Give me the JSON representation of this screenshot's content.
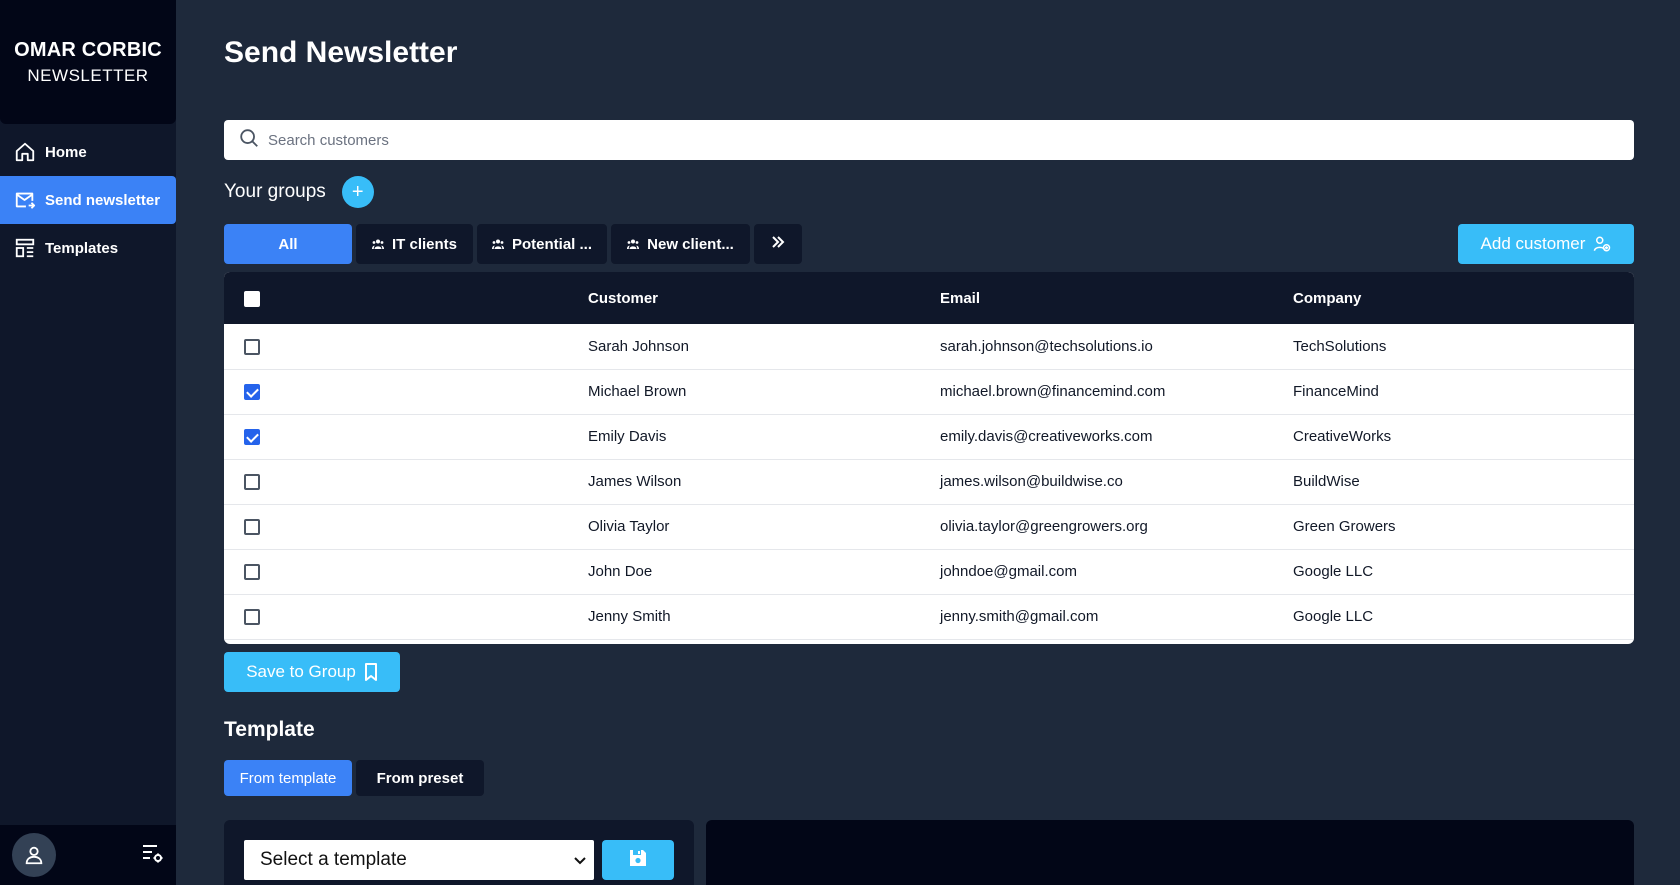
{
  "brand": {
    "name": "OMAR CORBIC",
    "subtitle": "NEWSLETTER"
  },
  "sidebar": {
    "items": [
      {
        "label": "Home",
        "icon": "home-icon",
        "active": false
      },
      {
        "label": "Send newsletter",
        "icon": "mail-send-icon",
        "active": true
      },
      {
        "label": "Templates",
        "icon": "layout-icon",
        "active": false
      }
    ]
  },
  "page": {
    "title": "Send Newsletter"
  },
  "search": {
    "placeholder": "Search customers",
    "value": ""
  },
  "groups": {
    "label": "Your groups",
    "add_label": "+",
    "tabs": [
      {
        "label": "All",
        "active": true
      },
      {
        "label": "IT clients",
        "active": false
      },
      {
        "label": "Potential ...",
        "active": false
      },
      {
        "label": "New client...",
        "active": false
      }
    ],
    "more_icon": "chevrons-right-icon"
  },
  "add_customer": {
    "label": "Add customer"
  },
  "table": {
    "headers": {
      "customer": "Customer",
      "email": "Email",
      "company": "Company"
    },
    "rows": [
      {
        "name": "Sarah Johnson",
        "email": "sarah.johnson@techsolutions.io",
        "company": "TechSolutions",
        "checked": false
      },
      {
        "name": "Michael Brown",
        "email": "michael.brown@financemind.com",
        "company": "FinanceMind",
        "checked": true
      },
      {
        "name": "Emily Davis",
        "email": "emily.davis@creativeworks.com",
        "company": "CreativeWorks",
        "checked": true
      },
      {
        "name": "James Wilson",
        "email": "james.wilson@buildwise.co",
        "company": "BuildWise",
        "checked": false
      },
      {
        "name": "Olivia Taylor",
        "email": "olivia.taylor@greengrowers.org",
        "company": "Green Growers",
        "checked": false
      },
      {
        "name": "John Doe",
        "email": "johndoe@gmail.com",
        "company": "Google LLC",
        "checked": false
      },
      {
        "name": "Jenny Smith",
        "email": "jenny.smith@gmail.com",
        "company": "Google LLC",
        "checked": false
      }
    ]
  },
  "save_group": {
    "label": "Save to Group"
  },
  "template": {
    "title": "Template",
    "tabs": [
      {
        "label": "From template",
        "active": true
      },
      {
        "label": "From preset",
        "active": false
      }
    ],
    "select_value": "Select a template"
  },
  "colors": {
    "accent": "#3b82f6",
    "accent_light": "#38bdf8",
    "bg": "#1e293b",
    "panel": "#0f172a"
  }
}
